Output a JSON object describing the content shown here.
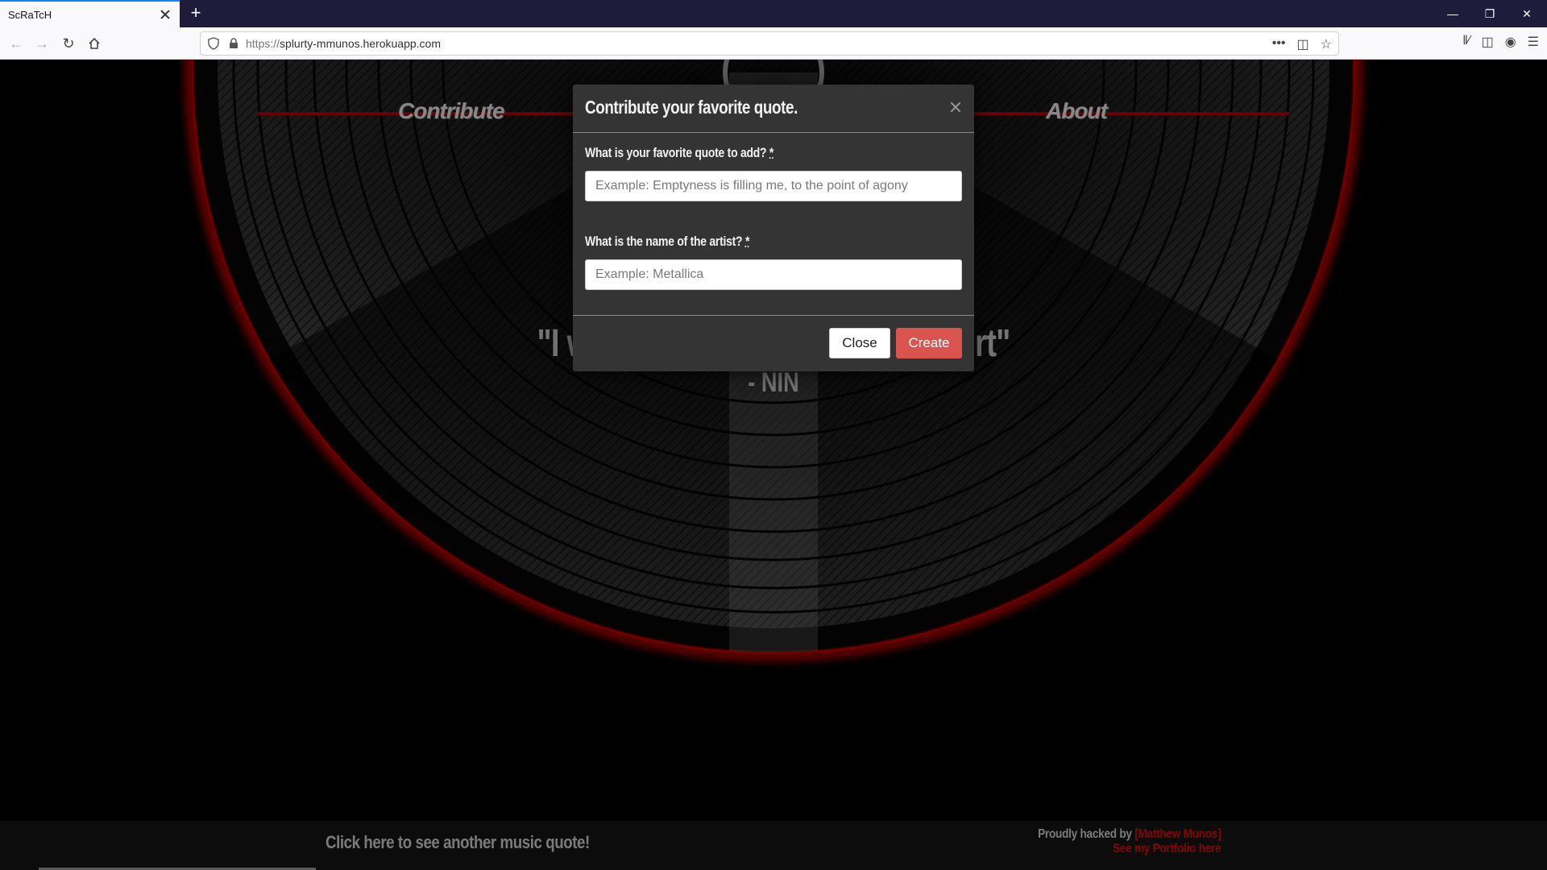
{
  "browser": {
    "tab_title": "ScRaTcH",
    "new_tab_symbol": "+",
    "url_protocol": "https://",
    "url_host": "splurty-mmunos.herokuapp.com",
    "overflow_symbol": "•••"
  },
  "nav": {
    "contribute_label": "Contribute",
    "about_label": "About"
  },
  "quote": {
    "text_left": "\"I wil",
    "text_right": "Hurt\"",
    "artist": "- NIN"
  },
  "modal": {
    "title": "Contribute your favorite quote.",
    "quote_label": "What is your favorite quote to add?",
    "quote_placeholder": "Example: Emptyness is filling me, to the point of agony",
    "artist_label": "What is the name of the artist?",
    "artist_placeholder": "Example: Metallica",
    "required_mark": "*",
    "close_button": "Close",
    "create_button": "Create"
  },
  "footer": {
    "another_quote_link": "Click here to see another music quote!",
    "credit_prefix": "Proudly hacked by ",
    "credit_author": "[Matthew Munos]",
    "portfolio_link": "See my Portfolio here"
  },
  "colors": {
    "accent_red": "#b0060c",
    "create_button": "#d9534f",
    "modal_bg": "#343434"
  }
}
